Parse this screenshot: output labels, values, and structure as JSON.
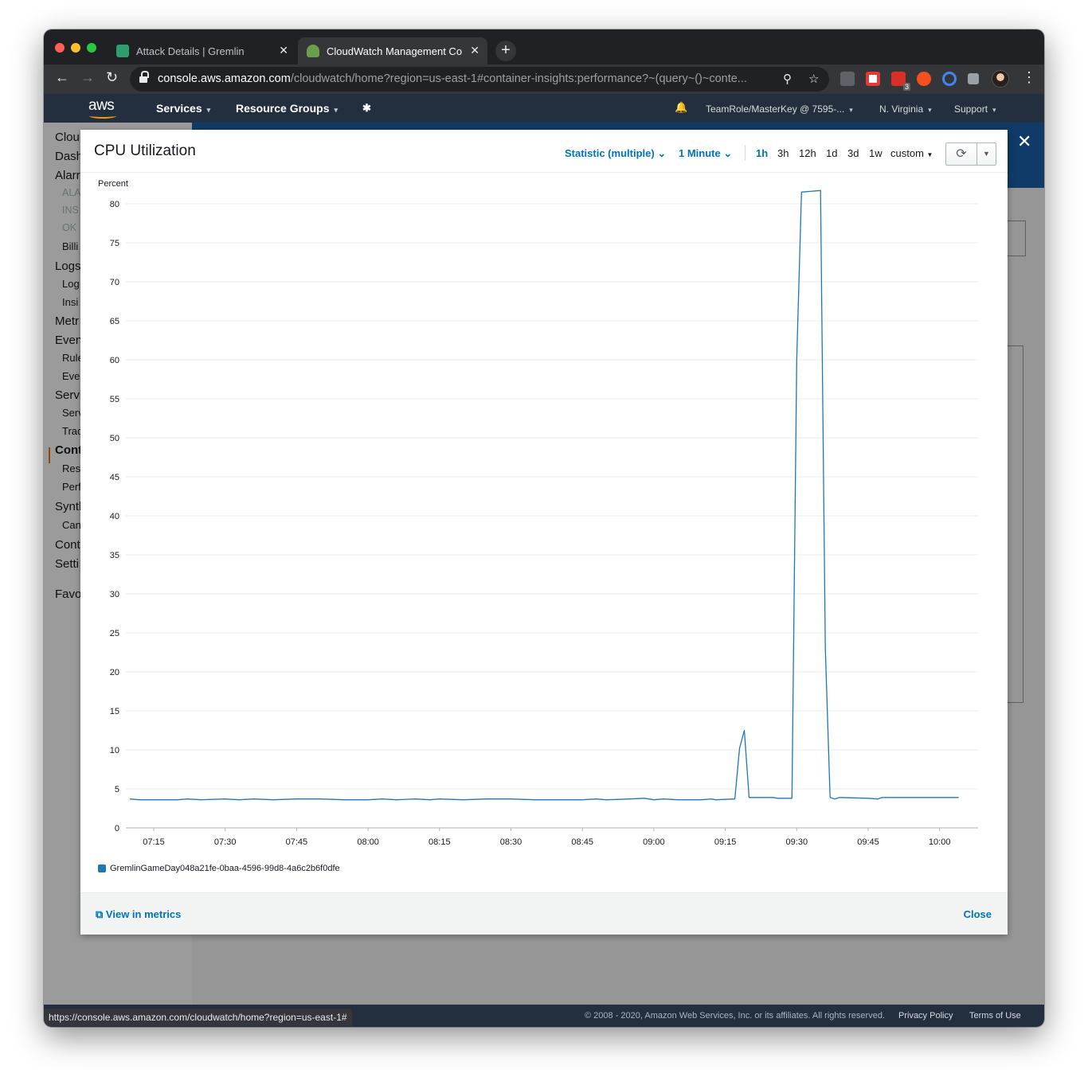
{
  "browser": {
    "tabs": [
      {
        "title": "Attack Details | Gremlin",
        "close": "✕"
      },
      {
        "title": "CloudWatch Management Console",
        "close": "✕"
      }
    ],
    "new_tab": "+",
    "url_host": "console.aws.amazon.com",
    "url_path": "/cloudwatch/home?region=us-east-1#container-insights:performance?~(query~()~conte...",
    "back": "←",
    "forward": "→",
    "reload": "↻",
    "zoom_icon": "⚲",
    "star_icon": "☆",
    "extension_badge": "3",
    "menu": "⋮",
    "status_url": "https://console.aws.amazon.com/cloudwatch/home?region=us-east-1#"
  },
  "aws_nav": {
    "logo": "aws",
    "services": "Services",
    "resource_groups": "Resource Groups",
    "pin": "✱",
    "bell": "🔔",
    "account": "TeamRole/MasterKey @ 7595-...",
    "region": "N. Virginia",
    "support": "Support",
    "caret": "▾"
  },
  "sidebar": {
    "items": [
      {
        "label": "Clou",
        "level": 1
      },
      {
        "label": "Dash",
        "level": 1
      },
      {
        "label": "Alarr",
        "level": 1
      },
      {
        "label": "ALA",
        "level": 3
      },
      {
        "label": "INS",
        "level": 3
      },
      {
        "label": "OK",
        "level": 3
      },
      {
        "label": "Billi",
        "level": 2
      },
      {
        "label": "Logs",
        "level": 1
      },
      {
        "label": "Log",
        "level": 2
      },
      {
        "label": "Insi",
        "level": 2
      },
      {
        "label": "Metr",
        "level": 1
      },
      {
        "label": "Even",
        "level": 1
      },
      {
        "label": "Rule",
        "level": 2
      },
      {
        "label": "Eve",
        "level": 2
      },
      {
        "label": "Servi",
        "level": 1
      },
      {
        "label": "Serv",
        "level": 2
      },
      {
        "label": "Trac",
        "level": 2
      },
      {
        "label": "Cont",
        "level": 1
      },
      {
        "label": "Res",
        "level": 2
      },
      {
        "label": "Perf",
        "level": 2
      },
      {
        "label": "Synth",
        "level": 1
      },
      {
        "label": "Can",
        "level": 2
      },
      {
        "label": "Cont",
        "level": 1
      },
      {
        "label": "Setti",
        "level": 1
      },
      {
        "label": "Favo",
        "level": 1
      }
    ]
  },
  "modal": {
    "title": "CPU Utilization",
    "statistic": "Statistic (multiple)",
    "period": "1 Minute",
    "ranges": [
      "1h",
      "3h",
      "12h",
      "1d",
      "3d",
      "1w",
      "custom"
    ],
    "active_range": "1h",
    "refresh_icon": "⟳",
    "dropdown_icon": "▼",
    "close_icon": "✕",
    "view_in_metrics": "View in metrics",
    "close_label": "Close",
    "external_link_icon": "⧉"
  },
  "footer": {
    "copyright": "© 2008 - 2020, Amazon Web Services, Inc. or its affiliates. All rights reserved.",
    "privacy": "Privacy Policy",
    "terms": "Terms of Use"
  },
  "colors": {
    "series": "#1f77b4",
    "link": "#0073bb",
    "aws_nav": "#232f3e",
    "accent": "#ff9900"
  },
  "chart_data": {
    "type": "line",
    "ylabel": "Percent",
    "ylim": [
      0,
      80
    ],
    "yticks": [
      0,
      5,
      10,
      15,
      20,
      25,
      30,
      35,
      40,
      45,
      50,
      55,
      60,
      65,
      70,
      75,
      80
    ],
    "xticks": [
      "07:15",
      "07:30",
      "07:45",
      "08:00",
      "08:15",
      "08:30",
      "08:45",
      "09:00",
      "09:15",
      "09:30",
      "09:45",
      "10:00"
    ],
    "grid": "horizontal",
    "legend_position": "bottom-left",
    "series": [
      {
        "name": "GremlinGameDay048a21fe-0baa-4596-99d8-4a6c2b6f0dfe",
        "points": [
          [
            "07:10",
            3.7
          ],
          [
            "07:12",
            3.6
          ],
          [
            "07:15",
            3.6
          ],
          [
            "07:20",
            3.6
          ],
          [
            "07:22",
            3.7
          ],
          [
            "07:25",
            3.6
          ],
          [
            "07:30",
            3.7
          ],
          [
            "07:33",
            3.6
          ],
          [
            "07:36",
            3.7
          ],
          [
            "07:40",
            3.6
          ],
          [
            "07:45",
            3.7
          ],
          [
            "07:50",
            3.7
          ],
          [
            "07:55",
            3.6
          ],
          [
            "08:00",
            3.6
          ],
          [
            "08:03",
            3.7
          ],
          [
            "08:06",
            3.6
          ],
          [
            "08:10",
            3.7
          ],
          [
            "08:13",
            3.6
          ],
          [
            "08:15",
            3.7
          ],
          [
            "08:20",
            3.6
          ],
          [
            "08:25",
            3.7
          ],
          [
            "08:30",
            3.7
          ],
          [
            "08:35",
            3.6
          ],
          [
            "08:40",
            3.6
          ],
          [
            "08:45",
            3.6
          ],
          [
            "08:48",
            3.7
          ],
          [
            "08:50",
            3.6
          ],
          [
            "08:55",
            3.7
          ],
          [
            "08:58",
            3.8
          ],
          [
            "09:00",
            3.6
          ],
          [
            "09:02",
            3.7
          ],
          [
            "09:05",
            3.6
          ],
          [
            "09:10",
            3.6
          ],
          [
            "09:12",
            3.7
          ],
          [
            "09:13",
            3.6
          ],
          [
            "09:17",
            3.7
          ],
          [
            "09:18",
            10.2
          ],
          [
            "09:19",
            12.5
          ],
          [
            "09:20",
            3.9
          ],
          [
            "09:25",
            3.9
          ],
          [
            "09:26",
            3.8
          ],
          [
            "09:29",
            3.8
          ],
          [
            "09:30",
            60.0
          ],
          [
            "09:31",
            81.5
          ],
          [
            "09:35",
            81.7
          ],
          [
            "09:36",
            23.0
          ],
          [
            "09:37",
            3.9
          ],
          [
            "09:38",
            3.7
          ],
          [
            "09:39",
            3.9
          ],
          [
            "09:45",
            3.8
          ],
          [
            "09:47",
            3.7
          ],
          [
            "09:48",
            3.9
          ],
          [
            "10:00",
            3.9
          ],
          [
            "10:04",
            3.9
          ]
        ]
      }
    ]
  }
}
